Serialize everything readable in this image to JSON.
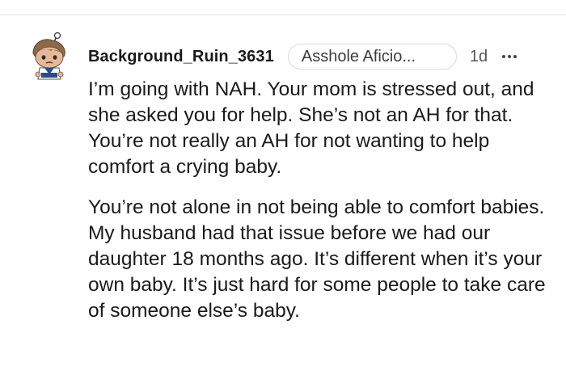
{
  "comment": {
    "author": "Background_Ruin_3631",
    "flair": "Asshole Aficio...",
    "age": "1d",
    "more_icon": "ellipsis-icon",
    "avatar_icon": "snoo-avatar-icon",
    "paragraphs": [
      "I’m going with NAH. Your mom is stressed out, and she asked you for help. She’s not an AH for that. You’re not really an AH for not wanting to help comfort a crying baby.",
      "You’re not alone in not being able to comfort babies. My husband had that issue before we had our daughter 18 months ago. It’s different when it’s your own baby. It’s just hard for some people to take care of someone else’s baby."
    ]
  },
  "colors": {
    "text": "#1a1a1b",
    "muted": "#555555",
    "flair_border": "#dadada",
    "divider": "#e6e6e6"
  }
}
